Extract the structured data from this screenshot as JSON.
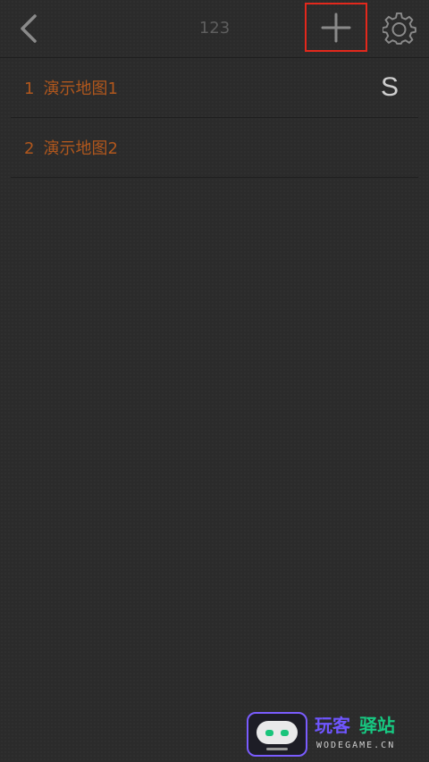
{
  "header": {
    "title": "123",
    "back_icon": "chevron-left-icon",
    "add_icon": "plus-icon",
    "settings_icon": "gear-icon"
  },
  "maps": [
    {
      "index": "1",
      "name": "演示地图1",
      "badge": "S"
    },
    {
      "index": "2",
      "name": "演示地图2",
      "badge": ""
    }
  ],
  "colors": {
    "background": "#2b2b2b",
    "item_text": "#b0571d",
    "highlight_border": "#e3281c",
    "icon": "#8a8a8a"
  },
  "watermark": {
    "text_part1": "玩客",
    "text_part2": "驿站",
    "domain": "WODEGAME.CN"
  }
}
